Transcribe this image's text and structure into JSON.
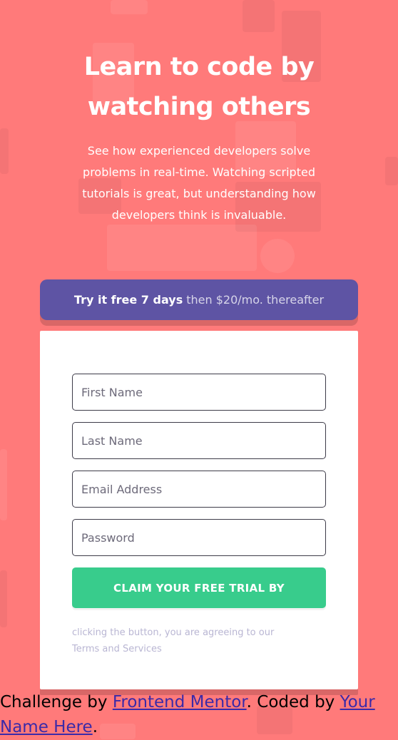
{
  "hero": {
    "title_line1": "Learn to code by",
    "title_line2": "watching others",
    "subtitle": "See how experienced developers solve problems in real-time. Watching scripted tutorials is great, but understanding how developers think is invaluable."
  },
  "trial_banner": {
    "bold_text": "Try it free 7 days",
    "light_text": "then $20/mo. thereafter"
  },
  "form": {
    "first_name": {
      "placeholder": "First Name",
      "value": ""
    },
    "last_name": {
      "placeholder": "Last Name",
      "value": ""
    },
    "email": {
      "placeholder": "Email Address",
      "value": ""
    },
    "password": {
      "placeholder": "Password",
      "value": ""
    },
    "submit_label": "CLAIM YOUR FREE TRIAL BY",
    "legal_text_1": "clicking the button, you are agreeing to our",
    "legal_text_2": "Terms and Services"
  },
  "attribution": {
    "prefix": "Challenge by",
    "mentor_link": "Frontend Mentor",
    "middle": ". Coded by",
    "author_link": "Your Name Here",
    "suffix": "."
  },
  "colors": {
    "background": "#ff7a7a",
    "banner": "#5e54a4",
    "button": "#38cc8c",
    "text_dark": "#3d3b48",
    "legal_text": "#b9b6d3"
  }
}
